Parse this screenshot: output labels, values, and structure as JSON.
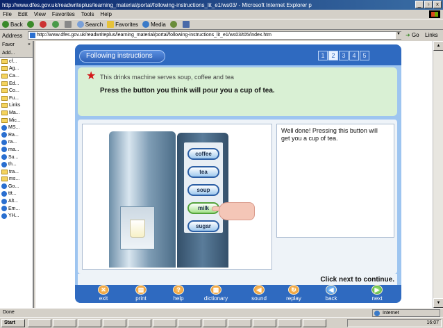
{
  "window": {
    "title": "http://www.dfes.gov.uk/readwriteplus/learning_material/portal/following-instructions_lit_e1/ws03/ - Microsoft Internet Explorer p"
  },
  "menu": [
    "File",
    "Edit",
    "View",
    "Favorites",
    "Tools",
    "Help"
  ],
  "toolbar": {
    "back": "Back",
    "search": "Search",
    "favorites": "Favorites",
    "media": "Media"
  },
  "address": {
    "label": "Address",
    "url": "http://www.dfes.gov.uk/readwriteplus/learning_material/portal/following-instructions_lit_e1/ws03/t05/index.htm",
    "go": "Go",
    "links": "Links"
  },
  "favorites": {
    "header": "Favor",
    "add": "Add",
    "items": [
      {
        "label": "cf...",
        "kind": "folder"
      },
      {
        "label": "Ag...",
        "kind": "folder"
      },
      {
        "label": "Ca...",
        "kind": "folder"
      },
      {
        "label": "Ed...",
        "kind": "folder"
      },
      {
        "label": "Co...",
        "kind": "folder"
      },
      {
        "label": "Fu...",
        "kind": "folder"
      },
      {
        "label": "Links",
        "kind": "folder"
      },
      {
        "label": "Ma...",
        "kind": "folder"
      },
      {
        "label": "Mic...",
        "kind": "folder"
      },
      {
        "label": "MS...",
        "kind": "ie"
      },
      {
        "label": "Ra...",
        "kind": "ie"
      },
      {
        "label": "ra...",
        "kind": "ie"
      },
      {
        "label": "ma...",
        "kind": "ie"
      },
      {
        "label": "Su...",
        "kind": "ie"
      },
      {
        "label": "th...",
        "kind": "ie"
      },
      {
        "label": "tra...",
        "kind": "folder"
      },
      {
        "label": "ms...",
        "kind": "folder"
      },
      {
        "label": "Go...",
        "kind": "ie"
      },
      {
        "label": "ttt...",
        "kind": "ie"
      },
      {
        "label": "Alt...",
        "kind": "ie"
      },
      {
        "label": "Em...",
        "kind": "ie"
      },
      {
        "label": "YH...",
        "kind": "ie"
      }
    ]
  },
  "lesson": {
    "title": "Following instructions",
    "pages": [
      "1",
      "2",
      "3",
      "4",
      "5"
    ],
    "active_page": 1,
    "intro": "This drinks machine serves soup, coffee and tea",
    "question": "Press the button you think will pour you a cup of tea.",
    "feedback": "Well done! Pressing this button will get you a cup of tea.",
    "next_hint": "Click next to continue.",
    "machine_buttons": [
      "coffee",
      "tea",
      "soup",
      "milk",
      "sugar"
    ],
    "pressed_button": "milk"
  },
  "nav": [
    {
      "label": "exit",
      "icon": "exit-icon",
      "glyph": "✕",
      "style": "orange"
    },
    {
      "label": "print",
      "icon": "print-icon",
      "glyph": "▤",
      "style": "orange"
    },
    {
      "label": "help",
      "icon": "help-icon",
      "glyph": "?",
      "style": "orange"
    },
    {
      "label": "dictionary",
      "icon": "dictionary-icon",
      "glyph": "▦",
      "style": "orange"
    },
    {
      "label": "sound",
      "icon": "sound-icon",
      "glyph": "◀",
      "style": "orange"
    },
    {
      "label": "replay",
      "icon": "replay-icon",
      "glyph": "↻",
      "style": "orange"
    },
    {
      "label": "back",
      "icon": "back-arrow-icon",
      "glyph": "◀",
      "style": "blue"
    },
    {
      "label": "next",
      "icon": "next-arrow-icon",
      "glyph": "▶",
      "style": "green"
    }
  ],
  "status": {
    "text": "Done",
    "zone": "Internet"
  },
  "taskbar": {
    "start": "Start",
    "clock": "16:07"
  },
  "colors": {
    "header_blue": "#2f6ac0",
    "instruction_green": "#d9f0d4",
    "star_red": "#d31818"
  }
}
